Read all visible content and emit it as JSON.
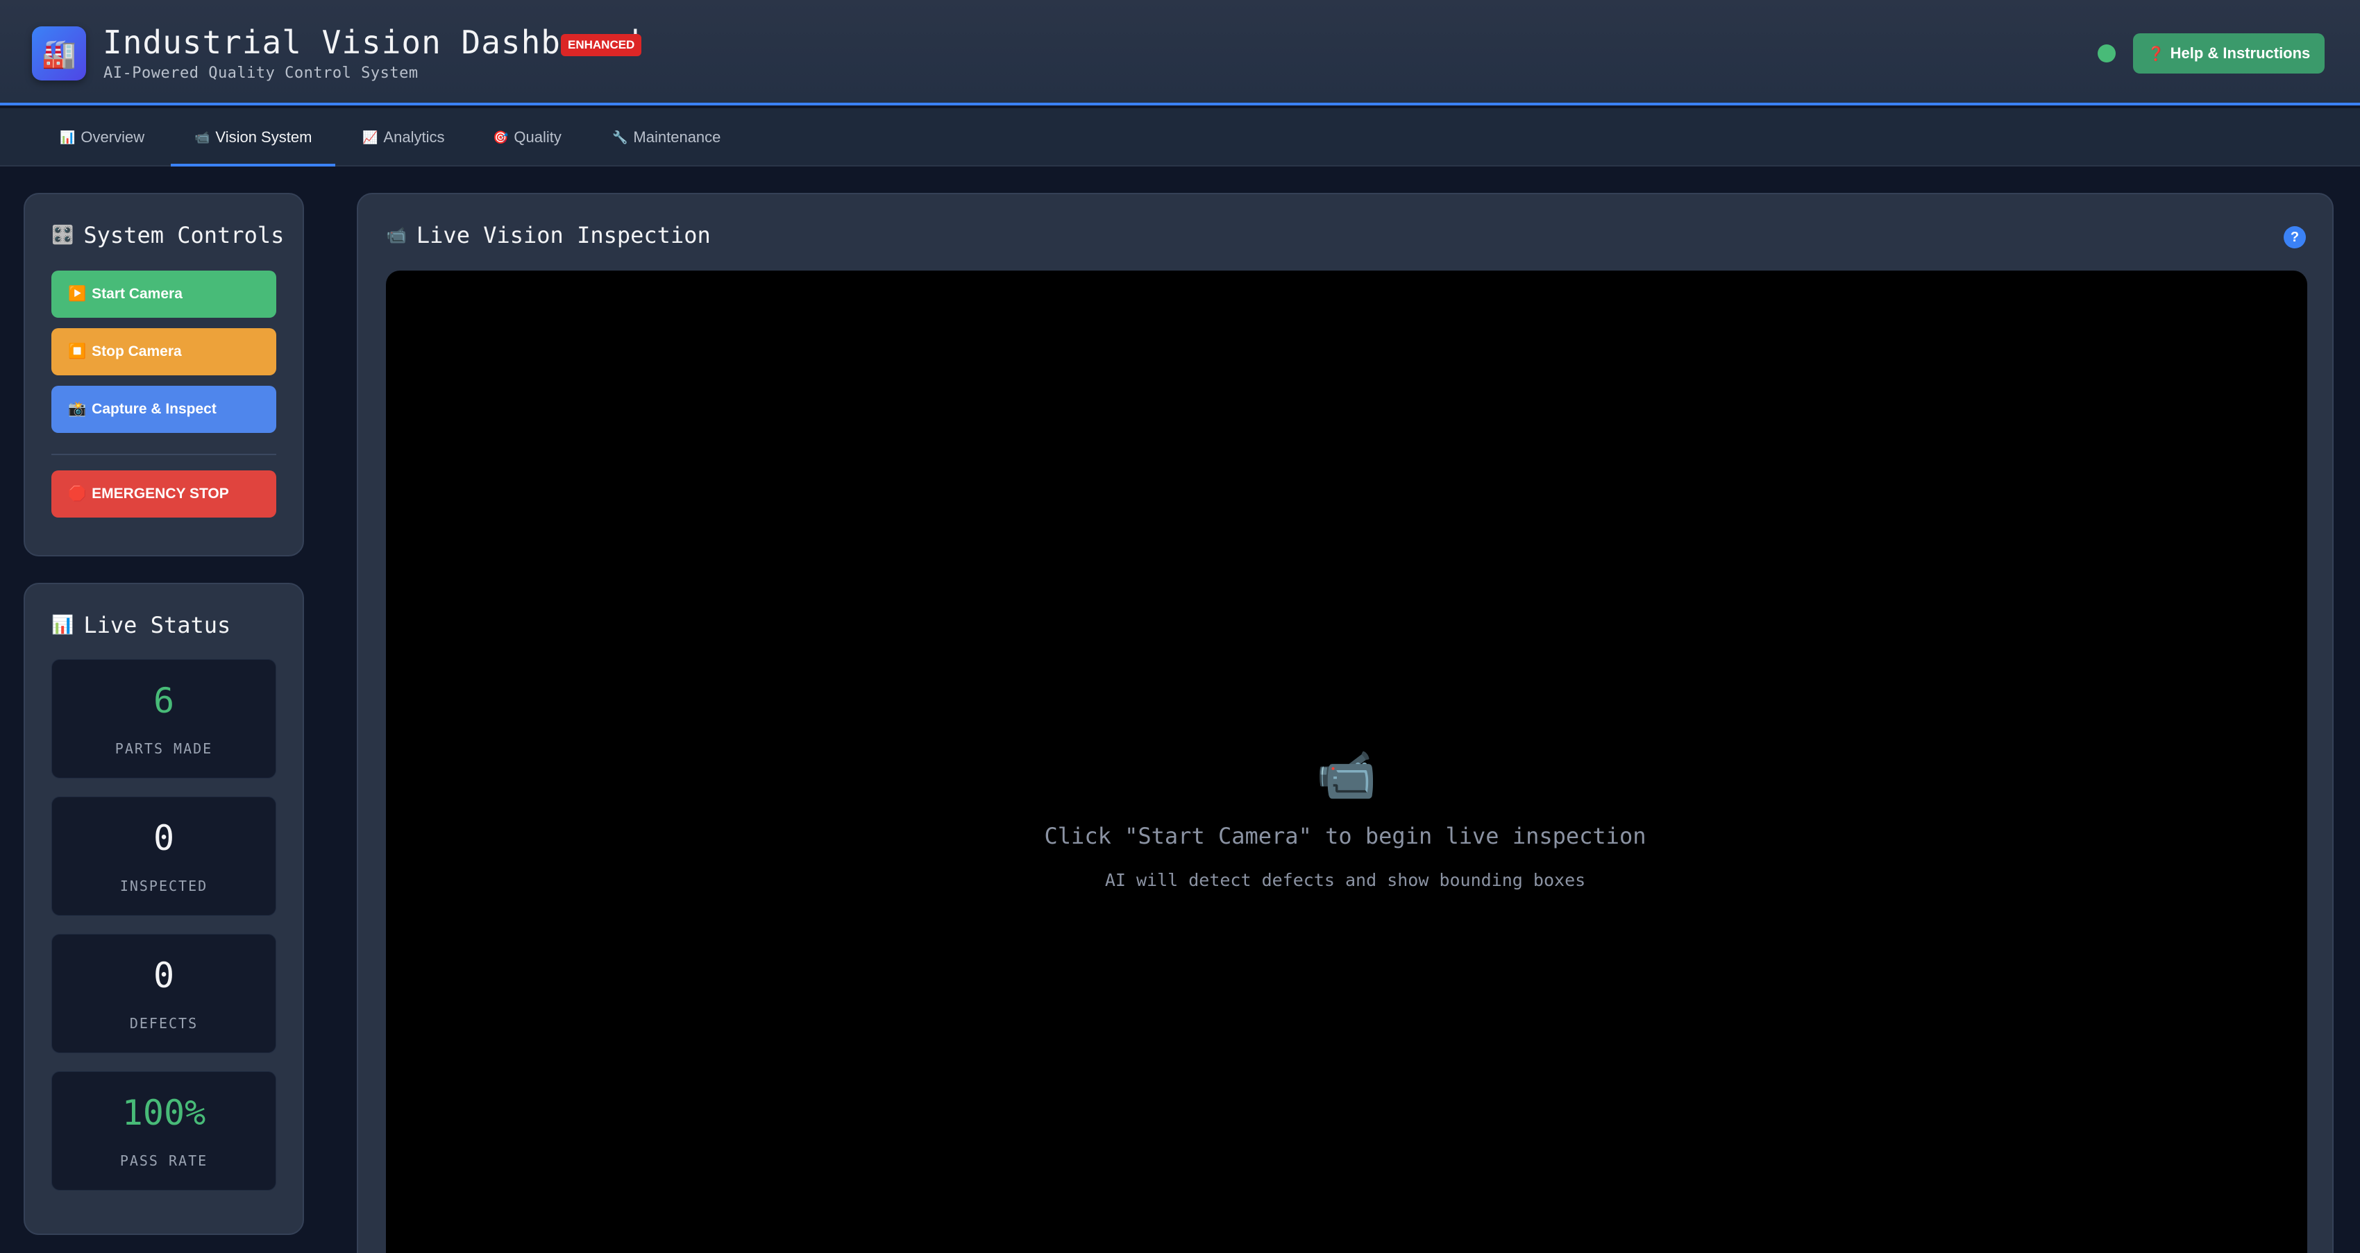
{
  "header": {
    "logo_icon": "🏭",
    "title": "Industrial Vision Dashboard",
    "badge": "ENHANCED",
    "subtitle": "AI-Powered Quality Control System",
    "status_color": "#48bb78",
    "help_icon": "❓",
    "help_label": "Help & Instructions"
  },
  "tabs": [
    {
      "icon": "📊",
      "label": "Overview"
    },
    {
      "icon": "📹",
      "label": "Vision System",
      "active": true
    },
    {
      "icon": "📈",
      "label": "Analytics"
    },
    {
      "icon": "🎯",
      "label": "Quality"
    },
    {
      "icon": "🔧",
      "label": "Maintenance"
    }
  ],
  "controls": {
    "icon": "🎛️",
    "title": "System Controls",
    "start": {
      "icon": "▶️",
      "label": "Start Camera"
    },
    "stop": {
      "icon": "⏹️",
      "label": "Stop Camera"
    },
    "capture": {
      "icon": "📸",
      "label": "Capture & Inspect"
    },
    "emergency": {
      "icon": "🛑",
      "label": "EMERGENCY STOP"
    }
  },
  "live_status": {
    "icon": "📊",
    "title": "Live Status",
    "stats": [
      {
        "value": "6",
        "label": "PARTS MADE",
        "color": "#48bb78"
      },
      {
        "value": "0",
        "label": "INSPECTED",
        "color": "#f3f4f6"
      },
      {
        "value": "0",
        "label": "DEFECTS",
        "color": "#f3f4f6"
      },
      {
        "value": "100%",
        "label": "PASS RATE",
        "color": "#48bb78"
      }
    ]
  },
  "vision": {
    "icon": "📹",
    "title": "Live Vision Inspection",
    "help": "?",
    "camera_icon": "📹",
    "message": "Click \"Start Camera\" to begin live inspection",
    "submessage": "AI will detect defects and show bounding boxes"
  },
  "colors": {
    "accent": "#3b82f6",
    "success": "#48bb78",
    "warning": "#eda23a",
    "danger": "#e0443e"
  }
}
